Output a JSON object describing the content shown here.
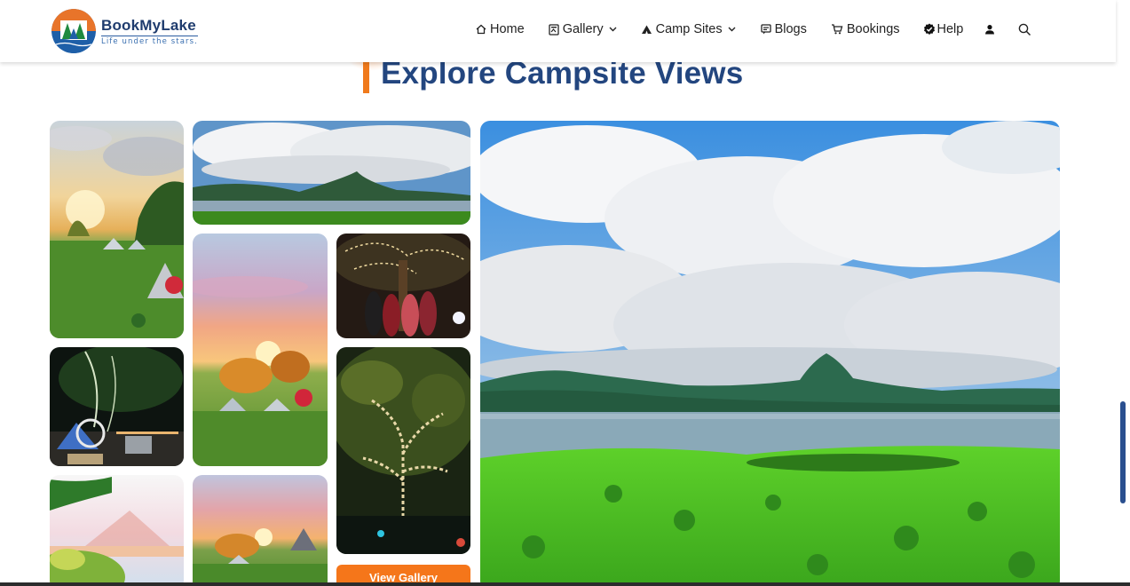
{
  "brand": {
    "name": "BookMyLake",
    "tagline": "Life under the stars."
  },
  "nav": {
    "items": [
      {
        "label": "Home",
        "icon": "home-icon"
      },
      {
        "label": "Gallery",
        "icon": "gallery-icon",
        "dropdown": true
      },
      {
        "label": "Camp Sites",
        "icon": "tent-icon",
        "dropdown": true
      },
      {
        "label": "Blogs",
        "icon": "blog-icon"
      },
      {
        "label": "Bookings",
        "icon": "cart-icon"
      },
      {
        "label": "Help",
        "icon": "help-badge-icon"
      }
    ],
    "user_icon": "user-icon",
    "search_icon": "search-icon"
  },
  "section": {
    "title": "Explore Campsite Views",
    "accent_color": "#f07a1c"
  },
  "gallery": {
    "view_button_label": "View Gallery",
    "button_color": "#f5761a"
  },
  "colors": {
    "title": "#23467f",
    "brand_blue": "#1f3c6e"
  }
}
